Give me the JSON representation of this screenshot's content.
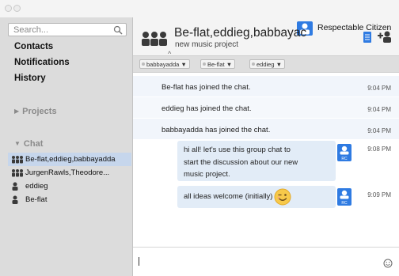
{
  "app": {
    "user_name": "Respectable Citizen"
  },
  "search": {
    "placeholder": "Search..."
  },
  "sidebar": {
    "nav": [
      {
        "label": "Contacts"
      },
      {
        "label": "Notifications"
      },
      {
        "label": "History"
      }
    ],
    "projects_label": "Projects",
    "chat_label": "Chat",
    "chats": [
      {
        "label": "Be-flat,eddieg,babbayadda",
        "icon": "group-icon",
        "selected": true
      },
      {
        "label": "JurgenRawls,Theodore...",
        "icon": "group-icon",
        "selected": false
      },
      {
        "label": "eddieg",
        "icon": "person-icon",
        "selected": false
      },
      {
        "label": "Be-flat",
        "icon": "person-icon",
        "selected": false
      }
    ]
  },
  "header": {
    "title": "Be-flat,eddieg,babbayac",
    "subtitle": "new music project"
  },
  "tags": [
    {
      "label": "babbayadda ▼"
    },
    {
      "label": "Be-flat ▼"
    },
    {
      "label": "eddieg ▼"
    }
  ],
  "messages": {
    "system": [
      {
        "text": "Be-flat has joined the chat.",
        "time": "9:04 PM"
      },
      {
        "text": "eddieg has joined the chat.",
        "time": "9:04 PM"
      },
      {
        "text": "babbayadda has joined the chat.",
        "time": "9:04 PM"
      }
    ],
    "chat": [
      {
        "lines": [
          "hi all! let's use this group chat to",
          "start the discussion about our new",
          "music project."
        ],
        "time": "9:08 PM",
        "avatar_label": "RC"
      },
      {
        "lines": [
          "all ideas welcome (initially)"
        ],
        "time": "9:09 PM",
        "avatar_label": "RC"
      }
    ]
  },
  "colors": {
    "accent_blue": "#2f7be2",
    "selected_row": "#c6d6ec",
    "bubble": "#e2ecf7"
  }
}
